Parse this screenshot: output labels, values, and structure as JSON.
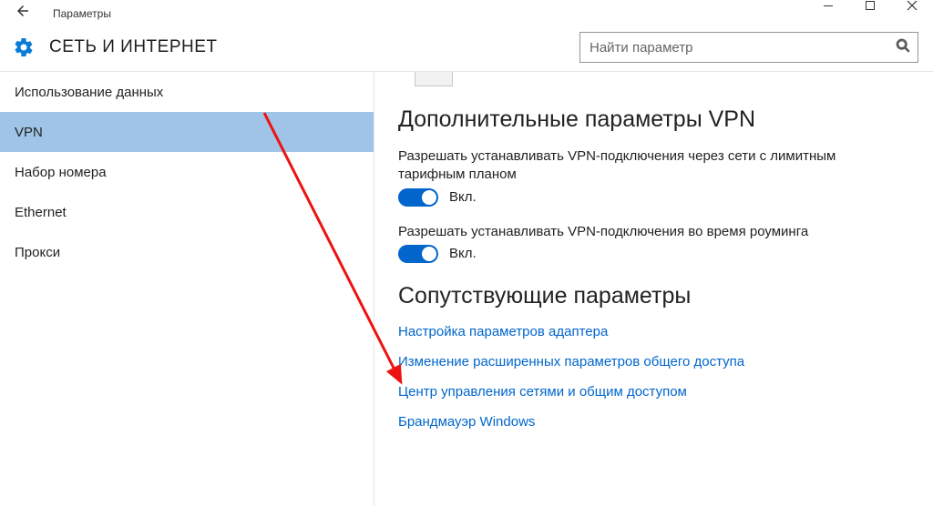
{
  "window": {
    "title": "Параметры"
  },
  "header": {
    "category": "СЕТЬ И ИНТЕРНЕТ"
  },
  "search": {
    "placeholder": "Найти параметр"
  },
  "sidebar": {
    "items": [
      {
        "label": "Использование данных",
        "selected": false
      },
      {
        "label": "VPN",
        "selected": true
      },
      {
        "label": "Набор номера",
        "selected": false
      },
      {
        "label": "Ethernet",
        "selected": false
      },
      {
        "label": "Прокси",
        "selected": false
      }
    ]
  },
  "main": {
    "advanced_heading": "Дополнительные параметры VPN",
    "settings": [
      {
        "desc": "Разрешать устанавливать VPN-подключения через сети с лимитным тарифным планом",
        "on": true,
        "on_label": "Вкл."
      },
      {
        "desc": "Разрешать устанавливать VPN-подключения во время роуминга",
        "on": true,
        "on_label": "Вкл."
      }
    ],
    "related_heading": "Сопутствующие параметры",
    "links": [
      "Настройка параметров адаптера",
      "Изменение расширенных параметров общего доступа",
      "Центр управления сетями и общим доступом",
      "Брандмауэр Windows"
    ]
  }
}
